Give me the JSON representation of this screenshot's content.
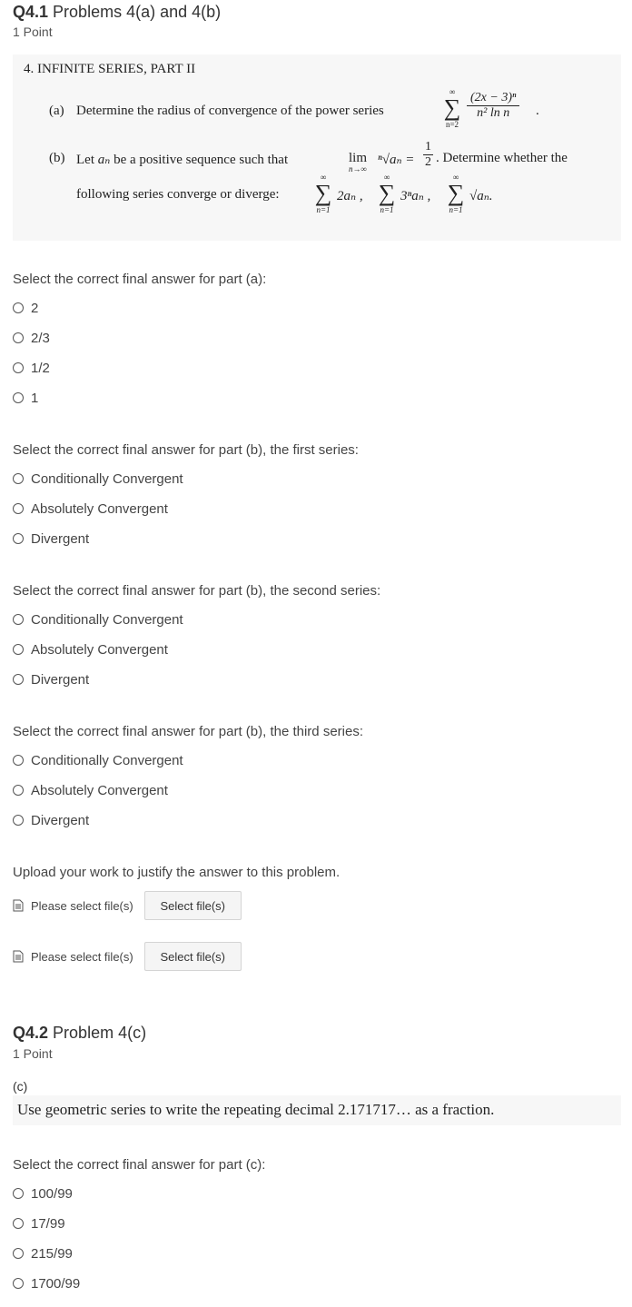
{
  "q41": {
    "number": "Q4.1",
    "title": "Problems 4(a) and 4(b)",
    "points": "1 Point",
    "problem": {
      "heading": "4. INFINITE SERIES, PART II",
      "part_a_label": "(a)",
      "part_a_text": "Determine the radius of convergence of the power series",
      "part_a_sum_top": "∞",
      "part_a_sum_bottom": "n=2",
      "part_a_num": "(2x − 3)ⁿ",
      "part_a_den": "n² ln n",
      "part_b_label": "(b)",
      "part_b_text1": "Let",
      "part_b_an": "aₙ",
      "part_b_text2": "be a positive sequence such that",
      "part_b_lim": "lim",
      "part_b_lim_sub": "n→∞",
      "part_b_root": "ⁿ√aₙ =",
      "part_b_half_num": "1",
      "part_b_half_den": "2",
      "part_b_text3": ". Determine whether the",
      "part_b_line2": "following series converge or diverge:",
      "series_1": "2aₙ ,",
      "series_2": "3ⁿaₙ ,",
      "series_3": "√aₙ.",
      "series_top": "∞",
      "series_bottom": "n=1"
    },
    "prompt_a": "Select the correct final answer for part (a):",
    "options_a": [
      "2",
      "2/3",
      "1/2",
      "1"
    ],
    "prompt_b1": "Select the correct final answer for part (b), the first series:",
    "prompt_b2": "Select the correct final answer for part (b), the second series:",
    "prompt_b3": "Select the correct final answer for part (b), the third series:",
    "options_b": [
      "Conditionally Convergent",
      "Absolutely Convergent",
      "Divergent"
    ],
    "upload_prompt": "Upload your work to justify the answer to this problem.",
    "upload_label": "Please select file(s)",
    "upload_button": "Select file(s)"
  },
  "q42": {
    "number": "Q4.2",
    "title": "Problem 4(c)",
    "points": "1 Point",
    "part_label": "(c)",
    "problem_text": "Use geometric series to write the repeating decimal 2.171717… as a fraction.",
    "prompt_c": "Select the correct final answer for part (c):",
    "options_c": [
      "100/99",
      "17/99",
      "215/99",
      "1700/99"
    ]
  }
}
